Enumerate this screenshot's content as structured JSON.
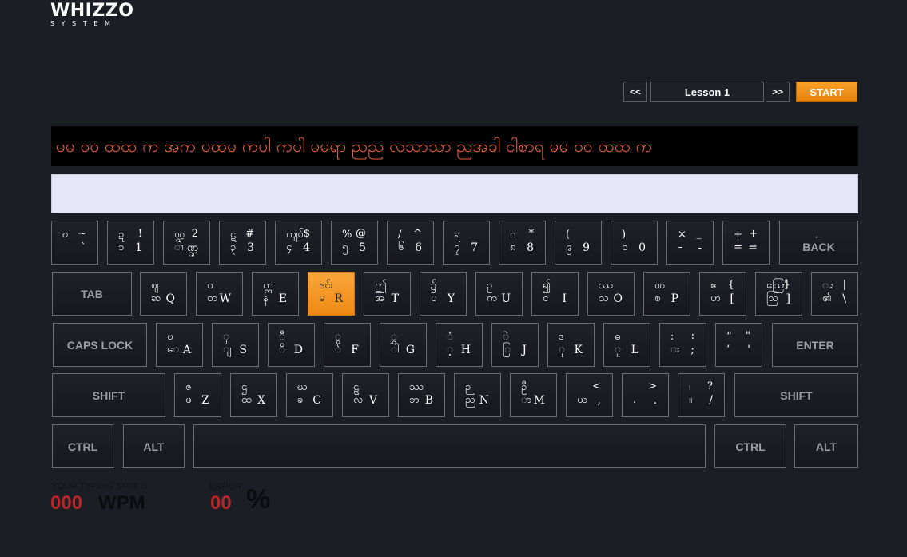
{
  "logo": {
    "main": "WHIZZO",
    "sub": "SYSTEM"
  },
  "lesson": {
    "prev_label": "<<",
    "name": "Lesson 1",
    "next_label": ">>",
    "start_label": "START"
  },
  "target_text": "မမ ဝဝ ထထ က အက ပထမ ကပါ ကပါ မမရာ ညည လသာသာ ညအခါ ငါစာရ မမ ဝဝ ထထ က",
  "input": {
    "value": "",
    "placeholder": ""
  },
  "keys": {
    "row1": [
      {
        "tl": "ဎ",
        "tr": "~",
        "bl": "",
        "br": "`"
      },
      {
        "tl": "ဍ",
        "tr": "!",
        "bl": "၁",
        "br": "1"
      },
      {
        "tl": "ဏ္ဍ",
        "tr": "2",
        "bl": "ၢ",
        "br": "ဏ္ဍ"
      },
      {
        "tl": "ဋ",
        "tr": "#",
        "bl": "၃",
        "br": "3"
      },
      {
        "tl": "ကျပ်",
        "tr": "$",
        "bl": "၄",
        "br": "4"
      },
      {
        "tl": "%",
        "tr": "@",
        "bl": "၅",
        "br": "5"
      },
      {
        "tl": "/",
        "tr": "^",
        "bl": "၆",
        "br": "6"
      },
      {
        "tl": "ရ",
        "tr": "",
        "bl": "၇",
        "br": "7"
      },
      {
        "tl": "ဂ",
        "tr": "*",
        "bl": "၈",
        "br": "8"
      },
      {
        "tl": "(",
        "tr": "",
        "bl": "၉",
        "br": "9"
      },
      {
        "tl": ")",
        "tr": "",
        "bl": "၀",
        "br": "0"
      },
      {
        "tl": "×",
        "tr": "_",
        "bl": "–",
        "br": "-"
      },
      {
        "tl": "+",
        "tr": "+",
        "bl": "=",
        "br": "="
      }
    ],
    "back": {
      "arrow": "←",
      "label": "BACK"
    },
    "tab": "TAB",
    "row2": [
      {
        "tl": "ဈ",
        "tr": "",
        "bl": "ဆ",
        "br": "Q"
      },
      {
        "tl": "ဝ",
        "tr": "",
        "bl": "တ",
        "br": "W"
      },
      {
        "tl": "ဣ",
        "tr": "",
        "bl": "န",
        "br": "E"
      },
      {
        "tl": "ၔင်း",
        "tr": "",
        "bl": "မ",
        "br": "R"
      },
      {
        "tl": "ဤ",
        "tr": "",
        "bl": "အ",
        "br": "T"
      },
      {
        "tl": "၌",
        "tr": "",
        "bl": "ပ",
        "br": "Y"
      },
      {
        "tl": "ဥ",
        "tr": "",
        "bl": "က",
        "br": "U"
      },
      {
        "tl": "၍",
        "tr": "",
        "bl": "င",
        "br": "I"
      },
      {
        "tl": "ဿ",
        "tr": "",
        "bl": "သ",
        "br": "O"
      },
      {
        "tl": "ဏ",
        "tr": "",
        "bl": "စ",
        "br": "P"
      },
      {
        "tl": "ဧ",
        "tr": "{",
        "bl": "ဟ",
        "br": "["
      },
      {
        "tl": "ဪ",
        "tr": "}",
        "bl": "ဩ",
        "br": "]"
      },
      {
        "tl": "ၗ",
        "tr": "|",
        "bl": "၏",
        "br": "\\"
      }
    ],
    "caps": "CAPS LOCK",
    "row3": [
      {
        "tl": "ဗ",
        "tr": "",
        "bl": "ေ",
        "br": "A"
      },
      {
        "tl": "ှ",
        "tr": "",
        "bl": "ျ",
        "br": "S"
      },
      {
        "tl": "ီ",
        "tr": "",
        "bl": "ိ",
        "br": "D"
      },
      {
        "tl": "ွ",
        "tr": "",
        "bl": "်",
        "br": "F"
      },
      {
        "tl": "ွှ",
        "tr": "",
        "bl": "ါ",
        "br": "G"
      },
      {
        "tl": "ံ",
        "tr": "",
        "bl": "့",
        "br": "H"
      },
      {
        "tl": "ဲ",
        "tr": "",
        "bl": "ြ",
        "br": "J"
      },
      {
        "tl": "ဒ",
        "tr": "",
        "bl": "ု",
        "br": "K"
      },
      {
        "tl": "ဓ",
        "tr": "",
        "bl": "ူ",
        "br": "L"
      },
      {
        "tl": ":",
        "tr": ":",
        "bl": "း",
        "br": ";"
      },
      {
        "tl": "“",
        "tr": "\"",
        "bl": "‘",
        "br": "'"
      }
    ],
    "enter": "ENTER",
    "shift_left": "SHIFT",
    "row4": [
      {
        "tl": "ဇ",
        "tr": "",
        "bl": "ဖ",
        "br": "Z"
      },
      {
        "tl": "ဌ",
        "tr": "",
        "bl": "ထ",
        "br": "X"
      },
      {
        "tl": "ဃ",
        "tr": "",
        "bl": "ခ",
        "br": "C"
      },
      {
        "tl": "ဠ",
        "tr": "",
        "bl": "လ",
        "br": "V"
      },
      {
        "tl": "ဿ",
        "tr": "",
        "bl": "ဘ",
        "br": "B"
      },
      {
        "tl": "ဉ",
        "tr": "",
        "bl": "ည",
        "br": "N"
      },
      {
        "tl": "ဦ",
        "tr": "",
        "bl": "ာ",
        "br": "M"
      },
      {
        "tl": "",
        "tr": "<",
        "bl": "ယ",
        "br": ","
      },
      {
        "tl": "",
        "tr": ">",
        "bl": ".",
        "br": "."
      },
      {
        "tl": "၊",
        "tr": "?",
        "bl": "။",
        "br": "/"
      }
    ],
    "shift_right": "SHIFT",
    "ctrl_left": "CTRL",
    "alt_left": "ALT",
    "space": "",
    "ctrl_right": "CTRL",
    "alt_right": "ALT",
    "highlighted": "R"
  },
  "stats": {
    "speed_label": "YOUR TYPING SPEED",
    "speed_value": "000",
    "speed_unit": "WPM",
    "error_label": "ERROR",
    "error_value": "00",
    "error_unit": "%"
  },
  "colors": {
    "background": "#1c1e25",
    "accent": "#ee8a14",
    "target_text": "#e8603a",
    "stat_value": "#b8262a"
  }
}
